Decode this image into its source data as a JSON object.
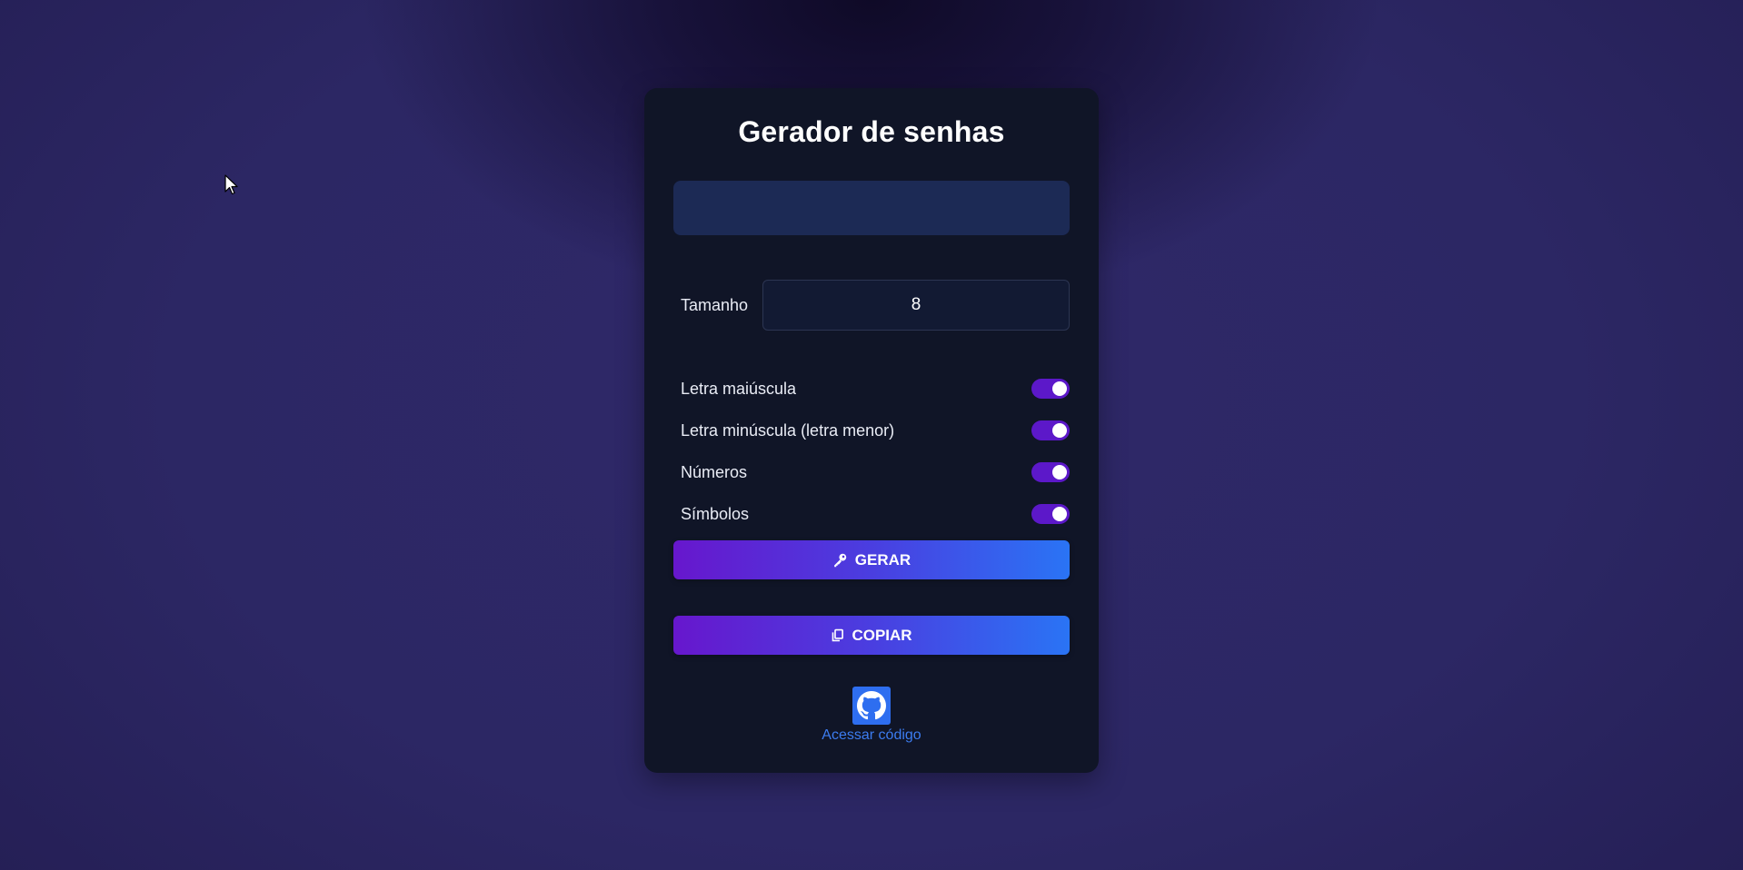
{
  "app": {
    "title": "Gerador de senhas"
  },
  "password_output": {
    "value": ""
  },
  "size": {
    "label": "Tamanho",
    "value": "8"
  },
  "options": [
    {
      "label": "Letra maiúscula",
      "enabled": true
    },
    {
      "label": "Letra minúscula (letra menor)",
      "enabled": true
    },
    {
      "label": "Números",
      "enabled": true
    },
    {
      "label": "Símbolos",
      "enabled": true
    }
  ],
  "buttons": {
    "generate_label": "GERAR",
    "copy_label": "COPIAR"
  },
  "footer": {
    "link_label": "Acessar código",
    "icon": "github-icon"
  },
  "colors": {
    "card_bg": "#101527",
    "toggle_on": "#5c18c9",
    "gradient_start": "#6717cd",
    "gradient_end": "#2a74f5",
    "link": "#3c7cf0"
  }
}
